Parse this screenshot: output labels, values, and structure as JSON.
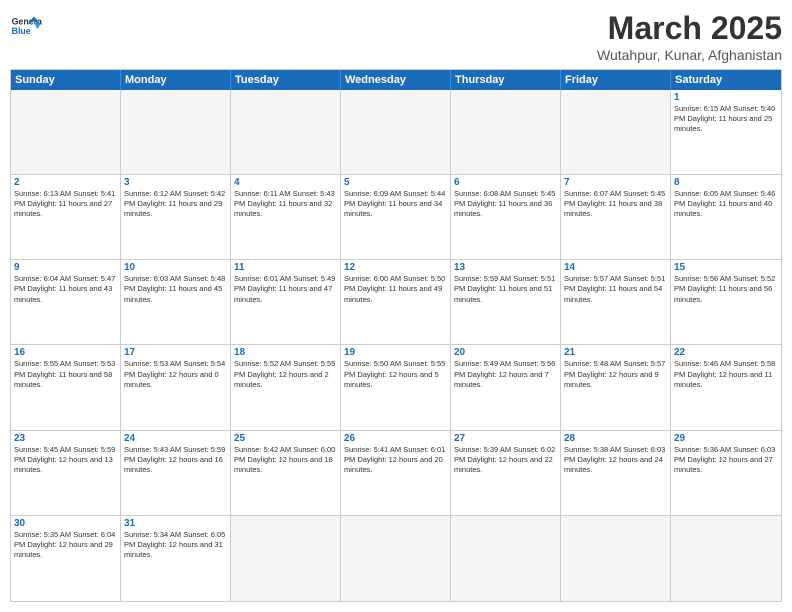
{
  "header": {
    "logo_general": "General",
    "logo_blue": "Blue",
    "month_year": "March 2025",
    "location": "Wutahpur, Kunar, Afghanistan"
  },
  "weekdays": [
    "Sunday",
    "Monday",
    "Tuesday",
    "Wednesday",
    "Thursday",
    "Friday",
    "Saturday"
  ],
  "rows": [
    [
      {
        "day": "",
        "text": ""
      },
      {
        "day": "",
        "text": ""
      },
      {
        "day": "",
        "text": ""
      },
      {
        "day": "",
        "text": ""
      },
      {
        "day": "",
        "text": ""
      },
      {
        "day": "",
        "text": ""
      },
      {
        "day": "1",
        "text": "Sunrise: 6:15 AM\nSunset: 5:40 PM\nDaylight: 11 hours and 25 minutes."
      }
    ],
    [
      {
        "day": "2",
        "text": "Sunrise: 6:13 AM\nSunset: 5:41 PM\nDaylight: 11 hours and 27 minutes."
      },
      {
        "day": "3",
        "text": "Sunrise: 6:12 AM\nSunset: 5:42 PM\nDaylight: 11 hours and 29 minutes."
      },
      {
        "day": "4",
        "text": "Sunrise: 6:11 AM\nSunset: 5:43 PM\nDaylight: 11 hours and 32 minutes."
      },
      {
        "day": "5",
        "text": "Sunrise: 6:09 AM\nSunset: 5:44 PM\nDaylight: 11 hours and 34 minutes."
      },
      {
        "day": "6",
        "text": "Sunrise: 6:08 AM\nSunset: 5:45 PM\nDaylight: 11 hours and 36 minutes."
      },
      {
        "day": "7",
        "text": "Sunrise: 6:07 AM\nSunset: 5:45 PM\nDaylight: 11 hours and 38 minutes."
      },
      {
        "day": "8",
        "text": "Sunrise: 6:05 AM\nSunset: 5:46 PM\nDaylight: 11 hours and 40 minutes."
      }
    ],
    [
      {
        "day": "9",
        "text": "Sunrise: 6:04 AM\nSunset: 5:47 PM\nDaylight: 11 hours and 43 minutes."
      },
      {
        "day": "10",
        "text": "Sunrise: 6:03 AM\nSunset: 5:48 PM\nDaylight: 11 hours and 45 minutes."
      },
      {
        "day": "11",
        "text": "Sunrise: 6:01 AM\nSunset: 5:49 PM\nDaylight: 11 hours and 47 minutes."
      },
      {
        "day": "12",
        "text": "Sunrise: 6:00 AM\nSunset: 5:50 PM\nDaylight: 11 hours and 49 minutes."
      },
      {
        "day": "13",
        "text": "Sunrise: 5:59 AM\nSunset: 5:51 PM\nDaylight: 11 hours and 51 minutes."
      },
      {
        "day": "14",
        "text": "Sunrise: 5:57 AM\nSunset: 5:51 PM\nDaylight: 11 hours and 54 minutes."
      },
      {
        "day": "15",
        "text": "Sunrise: 5:56 AM\nSunset: 5:52 PM\nDaylight: 11 hours and 56 minutes."
      }
    ],
    [
      {
        "day": "16",
        "text": "Sunrise: 5:55 AM\nSunset: 5:53 PM\nDaylight: 11 hours and 58 minutes."
      },
      {
        "day": "17",
        "text": "Sunrise: 5:53 AM\nSunset: 5:54 PM\nDaylight: 12 hours and 0 minutes."
      },
      {
        "day": "18",
        "text": "Sunrise: 5:52 AM\nSunset: 5:55 PM\nDaylight: 12 hours and 2 minutes."
      },
      {
        "day": "19",
        "text": "Sunrise: 5:50 AM\nSunset: 5:55 PM\nDaylight: 12 hours and 5 minutes."
      },
      {
        "day": "20",
        "text": "Sunrise: 5:49 AM\nSunset: 5:56 PM\nDaylight: 12 hours and 7 minutes."
      },
      {
        "day": "21",
        "text": "Sunrise: 5:48 AM\nSunset: 5:57 PM\nDaylight: 12 hours and 9 minutes."
      },
      {
        "day": "22",
        "text": "Sunrise: 5:46 AM\nSunset: 5:58 PM\nDaylight: 12 hours and 11 minutes."
      }
    ],
    [
      {
        "day": "23",
        "text": "Sunrise: 5:45 AM\nSunset: 5:59 PM\nDaylight: 12 hours and 13 minutes."
      },
      {
        "day": "24",
        "text": "Sunrise: 5:43 AM\nSunset: 5:59 PM\nDaylight: 12 hours and 16 minutes."
      },
      {
        "day": "25",
        "text": "Sunrise: 5:42 AM\nSunset: 6:00 PM\nDaylight: 12 hours and 18 minutes."
      },
      {
        "day": "26",
        "text": "Sunrise: 5:41 AM\nSunset: 6:01 PM\nDaylight: 12 hours and 20 minutes."
      },
      {
        "day": "27",
        "text": "Sunrise: 5:39 AM\nSunset: 6:02 PM\nDaylight: 12 hours and 22 minutes."
      },
      {
        "day": "28",
        "text": "Sunrise: 5:38 AM\nSunset: 6:03 PM\nDaylight: 12 hours and 24 minutes."
      },
      {
        "day": "29",
        "text": "Sunrise: 5:36 AM\nSunset: 6:03 PM\nDaylight: 12 hours and 27 minutes."
      }
    ],
    [
      {
        "day": "30",
        "text": "Sunrise: 5:35 AM\nSunset: 6:04 PM\nDaylight: 12 hours and 29 minutes."
      },
      {
        "day": "31",
        "text": "Sunrise: 5:34 AM\nSunset: 6:05 PM\nDaylight: 12 hours and 31 minutes."
      },
      {
        "day": "",
        "text": ""
      },
      {
        "day": "",
        "text": ""
      },
      {
        "day": "",
        "text": ""
      },
      {
        "day": "",
        "text": ""
      },
      {
        "day": "",
        "text": ""
      }
    ]
  ]
}
